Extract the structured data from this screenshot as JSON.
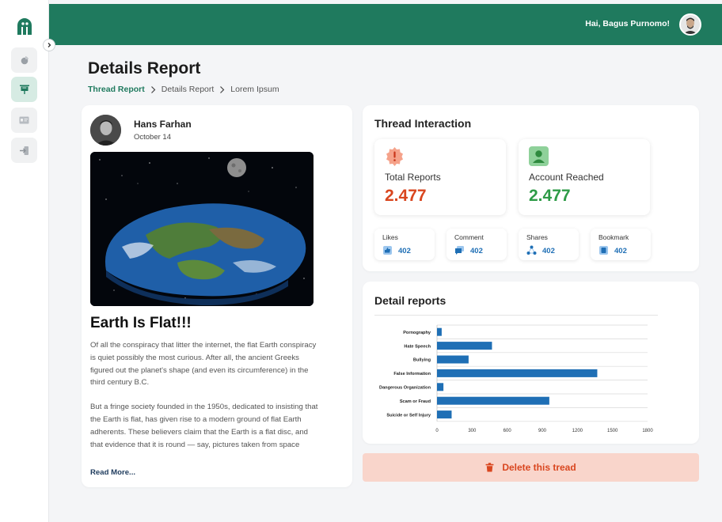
{
  "topbar": {
    "greeting": "Hai, Bagus Purnomo!"
  },
  "page": {
    "title": "Details Report",
    "breadcrumb": [
      "Thread Report",
      "Details Report",
      "Lorem Ipsum"
    ]
  },
  "post": {
    "author_name": "Hans Farhan",
    "date": "October 14",
    "title": "Earth Is Flat!!!",
    "paragraphs": [
      "Of all the conspiracy that litter the internet, the flat Earth conspiracy is quiet possibly the most curious. After all, the ancient Greeks figured out the planet's shape (and even its circumference) in the third century B.C.",
      "But a fringe society founded in the 1950s, dedicated to insisting that the Earth is flat, has given rise to a modern ground of flat Earth adherents. These believers claim that the Earth is a flat disc, and that evidence that it is round — say, pictures taken from space"
    ],
    "read_more": "Read More..."
  },
  "interaction": {
    "title": "Thread Interaction",
    "total_reports": {
      "label": "Total Reports",
      "value": "2.477",
      "color": "#d9461f",
      "icon": "alert-badge-icon"
    },
    "account_reached": {
      "label": "Account Reached",
      "value": "2.477",
      "color": "#2e9b47",
      "icon": "user-icon"
    },
    "mini": [
      {
        "label": "Likes",
        "value": "402",
        "icon": "like-icon"
      },
      {
        "label": "Comment",
        "value": "402",
        "icon": "comment-icon"
      },
      {
        "label": "Shares",
        "value": "402",
        "icon": "share-icon"
      },
      {
        "label": "Bookmark",
        "value": "402",
        "icon": "bookmark-icon"
      }
    ]
  },
  "detail_reports": {
    "title": "Detail reports"
  },
  "chart_data": {
    "type": "bar",
    "orientation": "horizontal",
    "categories": [
      "Pornography",
      "Hate Speech",
      "Bullying",
      "False Information",
      "Dangerous Organization",
      "Scam or Fraud",
      "Suicide or Self Injury"
    ],
    "values": [
      40,
      470,
      270,
      1370,
      55,
      960,
      125
    ],
    "xticks": [
      "0",
      "300",
      "600",
      "900",
      "1200",
      "1500",
      "1800"
    ],
    "xlim": [
      0,
      1800
    ],
    "bar_color": "#1f6fb5",
    "grid": true
  },
  "delete": {
    "label": "Delete this tread",
    "color": "#d9461f"
  }
}
